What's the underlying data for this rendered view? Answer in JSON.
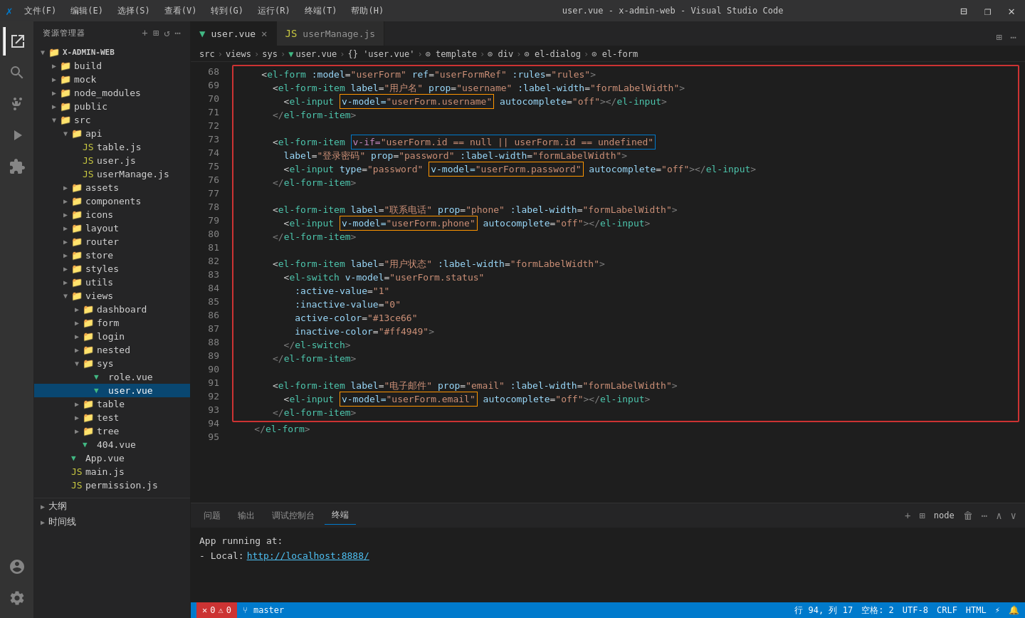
{
  "titleBar": {
    "icon": "✗",
    "menus": [
      "文件(F)",
      "编辑(E)",
      "选择(S)",
      "查看(V)",
      "转到(G)",
      "运行(R)",
      "终端(T)",
      "帮助(H)"
    ],
    "title": "user.vue - x-admin-web - Visual Studio Code",
    "windowControls": [
      "⊟",
      "❐",
      "✕"
    ]
  },
  "activityBar": {
    "items": [
      {
        "name": "explorer",
        "icon": "⧉",
        "active": true
      },
      {
        "name": "search",
        "icon": "🔍"
      },
      {
        "name": "source-control",
        "icon": "⑂"
      },
      {
        "name": "run",
        "icon": "▷"
      },
      {
        "name": "extensions",
        "icon": "⊞"
      }
    ],
    "bottom": [
      {
        "name": "accounts",
        "icon": "👤"
      },
      {
        "name": "settings",
        "icon": "⚙"
      }
    ]
  },
  "sidebar": {
    "header": "资源管理器",
    "headerIcons": [
      "⋯"
    ],
    "rootName": "X-ADMIN-WEB",
    "tree": [
      {
        "id": "build",
        "label": "build",
        "indent": 1,
        "type": "folder",
        "collapsed": true
      },
      {
        "id": "mock",
        "label": "mock",
        "indent": 1,
        "type": "folder",
        "collapsed": true
      },
      {
        "id": "node_modules",
        "label": "node_modules",
        "indent": 1,
        "type": "folder",
        "collapsed": true
      },
      {
        "id": "public",
        "label": "public",
        "indent": 1,
        "type": "folder",
        "collapsed": true
      },
      {
        "id": "src",
        "label": "src",
        "indent": 1,
        "type": "folder",
        "collapsed": false
      },
      {
        "id": "api",
        "label": "api",
        "indent": 2,
        "type": "folder",
        "collapsed": false
      },
      {
        "id": "table.js",
        "label": "table.js",
        "indent": 3,
        "type": "js"
      },
      {
        "id": "user.js",
        "label": "user.js",
        "indent": 3,
        "type": "js"
      },
      {
        "id": "userManage.js",
        "label": "userManage.js",
        "indent": 3,
        "type": "js"
      },
      {
        "id": "assets",
        "label": "assets",
        "indent": 2,
        "type": "folder",
        "collapsed": true
      },
      {
        "id": "components",
        "label": "components",
        "indent": 2,
        "type": "folder",
        "collapsed": true
      },
      {
        "id": "icons",
        "label": "icons",
        "indent": 2,
        "type": "folder",
        "collapsed": true
      },
      {
        "id": "layout",
        "label": "layout",
        "indent": 2,
        "type": "folder",
        "collapsed": true
      },
      {
        "id": "router",
        "label": "router",
        "indent": 2,
        "type": "folder",
        "collapsed": true
      },
      {
        "id": "store",
        "label": "store",
        "indent": 2,
        "type": "folder",
        "collapsed": true
      },
      {
        "id": "styles",
        "label": "styles",
        "indent": 2,
        "type": "folder",
        "collapsed": true
      },
      {
        "id": "utils",
        "label": "utils",
        "indent": 2,
        "type": "folder",
        "collapsed": true
      },
      {
        "id": "views",
        "label": "views",
        "indent": 2,
        "type": "folder",
        "collapsed": false
      },
      {
        "id": "dashboard",
        "label": "dashboard",
        "indent": 3,
        "type": "folder",
        "collapsed": true
      },
      {
        "id": "form",
        "label": "form",
        "indent": 3,
        "type": "folder",
        "collapsed": true
      },
      {
        "id": "login",
        "label": "login",
        "indent": 3,
        "type": "folder",
        "collapsed": true
      },
      {
        "id": "nested",
        "label": "nested",
        "indent": 3,
        "type": "folder",
        "collapsed": true
      },
      {
        "id": "sys",
        "label": "sys",
        "indent": 3,
        "type": "folder",
        "collapsed": false
      },
      {
        "id": "role.vue",
        "label": "role.vue",
        "indent": 4,
        "type": "vue"
      },
      {
        "id": "user.vue",
        "label": "user.vue",
        "indent": 4,
        "type": "vue",
        "selected": true
      },
      {
        "id": "table",
        "label": "table",
        "indent": 3,
        "type": "folder",
        "collapsed": true
      },
      {
        "id": "test",
        "label": "test",
        "indent": 3,
        "type": "folder",
        "collapsed": true
      },
      {
        "id": "tree",
        "label": "tree",
        "indent": 3,
        "type": "folder",
        "collapsed": true
      },
      {
        "id": "404.vue",
        "label": "404.vue",
        "indent": 3,
        "type": "vue"
      },
      {
        "id": "App.vue",
        "label": "App.vue",
        "indent": 2,
        "type": "vue"
      },
      {
        "id": "main.js",
        "label": "main.js",
        "indent": 2,
        "type": "js"
      },
      {
        "id": "permission.js",
        "label": "permission.js",
        "indent": 2,
        "type": "js"
      }
    ],
    "bottomItems": [
      {
        "id": "outline",
        "label": "大纲"
      },
      {
        "id": "timeline",
        "label": "时间线"
      }
    ]
  },
  "tabs": [
    {
      "label": "user.vue",
      "type": "vue",
      "active": true,
      "closable": true
    },
    {
      "label": "userManage.js",
      "type": "js",
      "active": false,
      "closable": false
    }
  ],
  "breadcrumb": [
    {
      "label": "src"
    },
    {
      "label": "views"
    },
    {
      "label": "sys"
    },
    {
      "label": "user.vue",
      "icon": "vue"
    },
    {
      "label": "{} 'user.vue'"
    },
    {
      "label": "⊙ template"
    },
    {
      "label": "⊙ div"
    },
    {
      "label": "⊙ el-dialog"
    },
    {
      "label": "⊙ el-form"
    }
  ],
  "codeLines": [
    {
      "num": 68,
      "content": "    <el-form :model=\"userForm\" ref=\"userFormRef\" :rules=\"rules\">"
    },
    {
      "num": 69,
      "content": "      <el-form-item label=\"用户名\" prop=\"username\" :label-width=\"formLabelWidth\">",
      "highlight": true
    },
    {
      "num": 70,
      "content": "        <el-input v-model=\"userForm.username\" autocomplete=\"off\"></el-input>",
      "vmodel": "v-model=\"userForm.username\""
    },
    {
      "num": 71,
      "content": "      </el-form-item>"
    },
    {
      "num": 72,
      "content": ""
    },
    {
      "num": 73,
      "content": "      <el-form-item v-if=\"userForm.id == null || userForm.id == undefined\"",
      "vif": "v-if=\"userForm.id == null || userForm.id == undefined\""
    },
    {
      "num": 74,
      "content": "        label=\"登录密码\" prop=\"password\" :label-width=\"formLabelWidth\">"
    },
    {
      "num": 75,
      "content": "        <el-input type=\"password\" v-model=\"userForm.password\" autocomplete=\"off\"></el-input>",
      "vmodel": "v-model=\"userForm.password\""
    },
    {
      "num": 76,
      "content": "      </el-form-item>"
    },
    {
      "num": 77,
      "content": ""
    },
    {
      "num": 78,
      "content": "      <el-form-item label=\"联系电话\" prop=\"phone\" :label-width=\"formLabelWidth\">"
    },
    {
      "num": 79,
      "content": "        <el-input v-model=\"userForm.phone\" autocomplete=\"off\"></el-input>",
      "vmodel": "v-model=\"userForm.phone\""
    },
    {
      "num": 80,
      "content": "      </el-form-item>"
    },
    {
      "num": 81,
      "content": ""
    },
    {
      "num": 82,
      "content": "      <el-form-item label=\"用户状态\" :label-width=\"formLabelWidth\">"
    },
    {
      "num": 83,
      "content": "        <el-switch v-model=\"userForm.status\""
    },
    {
      "num": 84,
      "content": "          :active-value=\"1\""
    },
    {
      "num": 85,
      "content": "          :inactive-value=\"0\""
    },
    {
      "num": 86,
      "content": "          active-color=\"#13ce66\""
    },
    {
      "num": 87,
      "content": "          inactive-color=\"#ff4949\">"
    },
    {
      "num": 88,
      "content": "        </el-switch>"
    },
    {
      "num": 89,
      "content": "      </el-form-item>"
    },
    {
      "num": 90,
      "content": ""
    },
    {
      "num": 91,
      "content": "      <el-form-item label=\"电子邮件\" prop=\"email\" :label-width=\"formLabelWidth\">"
    },
    {
      "num": 92,
      "content": "        <el-input v-model=\"userForm.email\" autocomplete=\"off\"></el-input>",
      "vmodel": "v-model=\"userForm.email\""
    },
    {
      "num": 93,
      "content": "      </el-form-item>"
    },
    {
      "num": 94,
      "content": "    </el-form>"
    },
    {
      "num": 95,
      "content": ""
    }
  ],
  "statusBar": {
    "errors": "0",
    "warnings": "0",
    "branch": "master",
    "position": "行 94, 列 17",
    "spaces": "空格: 2",
    "encoding": "UTF-8",
    "lineEnding": "CRLF",
    "language": "HTML"
  },
  "bottomPanel": {
    "tabs": [
      "问题",
      "输出",
      "调试控制台",
      "终端"
    ],
    "activeTab": "终端",
    "content": [
      "App running at:",
      "- Local:    http://localhost:8888/"
    ],
    "terminalLabel": "node"
  }
}
